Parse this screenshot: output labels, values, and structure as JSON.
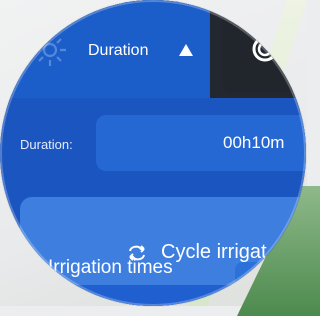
{
  "tabs": {
    "active_label": "Duration",
    "active_icon": "up-triangle-icon",
    "left_icon": "gear-icon",
    "inactive_icon": "power-icon"
  },
  "duration": {
    "label": "Duration:",
    "value": "00h10m"
  },
  "cycle": {
    "label": "Cycle irrigat",
    "icon": "cycle-icon"
  },
  "irrigation": {
    "label": "Irrigation times"
  },
  "colors": {
    "primary": "#1c5ec9",
    "dark": "#232830",
    "panel": "#3d7edf"
  }
}
